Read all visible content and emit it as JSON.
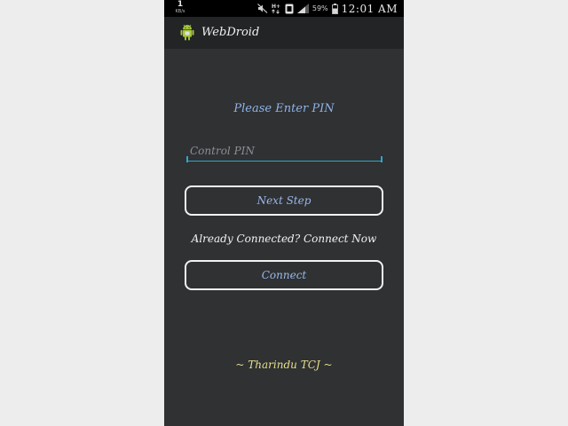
{
  "status_bar": {
    "net_speed_value": "1",
    "net_speed_unit": "KB/s",
    "icons": [
      "mute-icon",
      "hplus-data-icon",
      "vibrate-icon",
      "signal-icon",
      "battery-icon"
    ],
    "network_type": "H+",
    "battery_percent": "59%",
    "time": "12:01 AM"
  },
  "action_bar": {
    "icon": "android-robot-icon",
    "title": "WebDroid"
  },
  "form": {
    "prompt": "Please Enter PIN",
    "pin_placeholder": "Control PIN",
    "pin_value": "",
    "next_button": "Next Step",
    "already_text": "Already Connected? Connect Now",
    "connect_button": "Connect"
  },
  "footer": {
    "credit": "~ Tharindu TCJ ~"
  },
  "colors": {
    "screen_bg": "#2f3133",
    "action_bar_bg": "#222425",
    "accent_blue": "#8fb3e8",
    "input_underline": "#2fa7c7",
    "credit_yellow": "#e9df8a"
  }
}
